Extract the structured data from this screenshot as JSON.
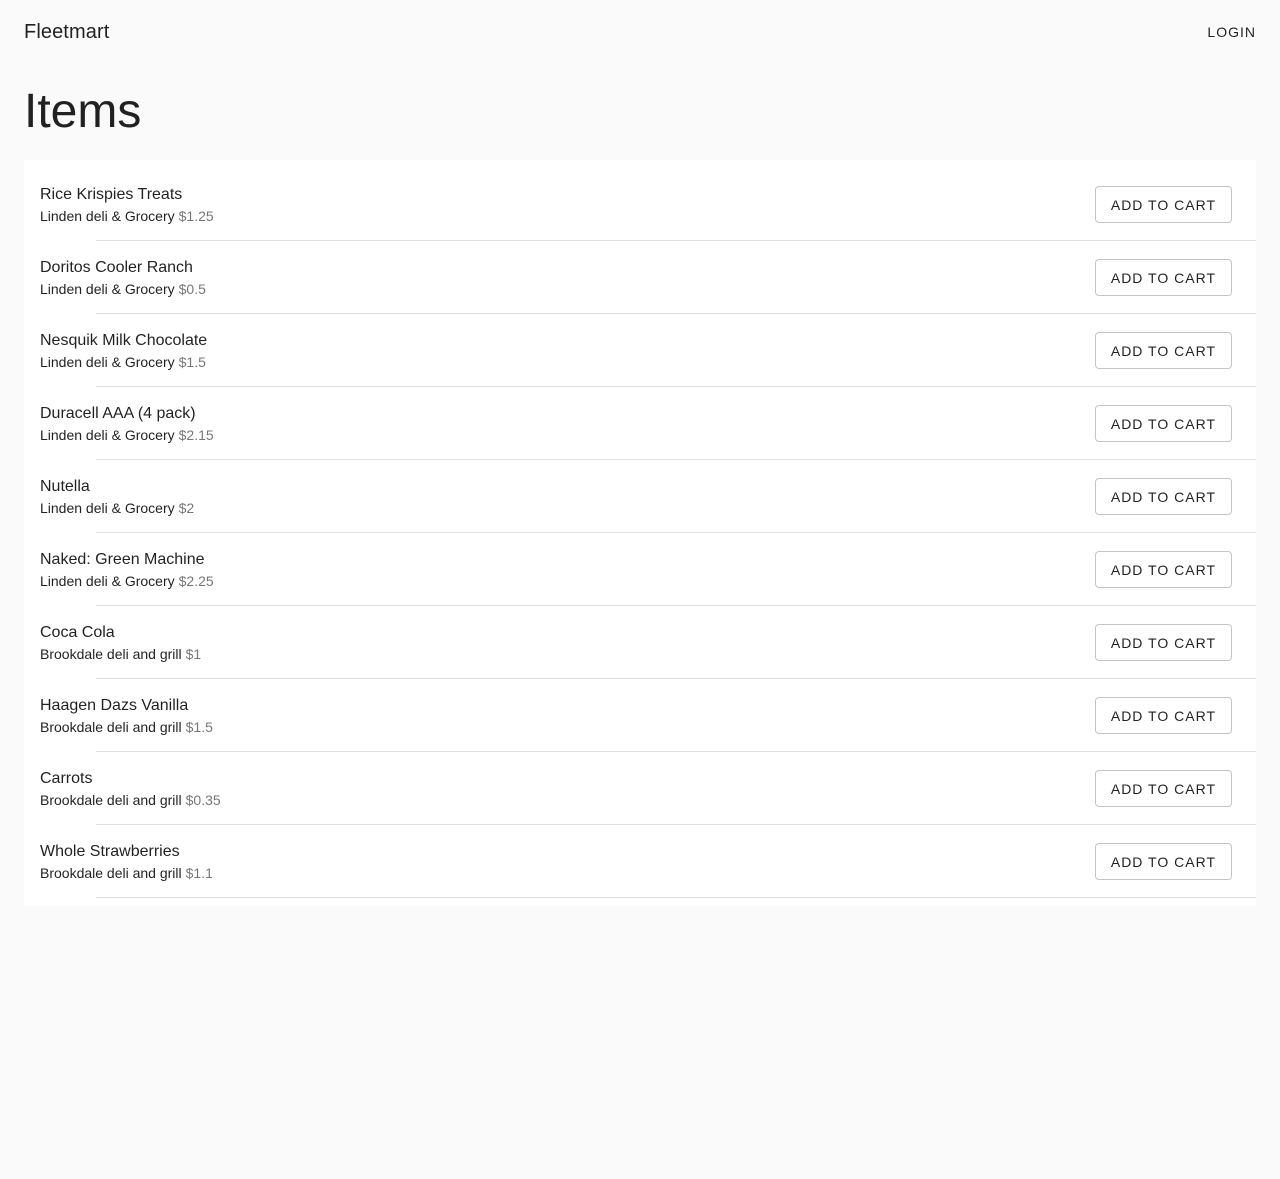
{
  "header": {
    "brand": "Fleetmart",
    "login_label": "LOGIN"
  },
  "page": {
    "title": "Items"
  },
  "items": [
    {
      "name": "Rice Krispies Treats",
      "store": "Linden deli & Grocery",
      "price": "$1.25",
      "button_label": "ADD TO CART"
    },
    {
      "name": "Doritos Cooler Ranch",
      "store": "Linden deli & Grocery",
      "price": "$0.5",
      "button_label": "ADD TO CART"
    },
    {
      "name": "Nesquik Milk Chocolate",
      "store": "Linden deli & Grocery",
      "price": "$1.5",
      "button_label": "ADD TO CART"
    },
    {
      "name": "Duracell AAA (4 pack)",
      "store": "Linden deli & Grocery",
      "price": "$2.15",
      "button_label": "ADD TO CART"
    },
    {
      "name": "Nutella",
      "store": "Linden deli & Grocery",
      "price": "$2",
      "button_label": "ADD TO CART"
    },
    {
      "name": "Naked: Green Machine",
      "store": "Linden deli & Grocery",
      "price": "$2.25",
      "button_label": "ADD TO CART"
    },
    {
      "name": "Coca Cola",
      "store": "Brookdale deli and grill",
      "price": "$1",
      "button_label": "ADD TO CART"
    },
    {
      "name": "Haagen Dazs Vanilla",
      "store": "Brookdale deli and grill",
      "price": "$1.5",
      "button_label": "ADD TO CART"
    },
    {
      "name": "Carrots",
      "store": "Brookdale deli and grill",
      "price": "$0.35",
      "button_label": "ADD TO CART"
    },
    {
      "name": "Whole Strawberries",
      "store": "Brookdale deli and grill",
      "price": "$1.1",
      "button_label": "ADD TO CART"
    }
  ]
}
